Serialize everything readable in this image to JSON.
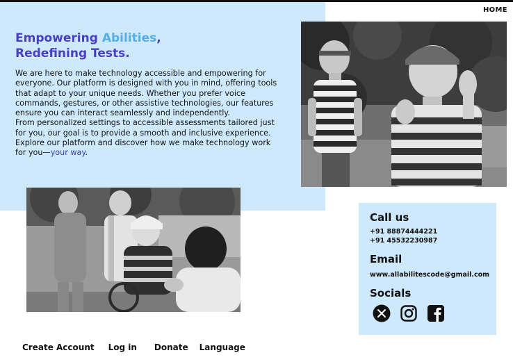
{
  "nav": {
    "home_label": "HOME"
  },
  "hero": {
    "title_part1": "Empowering ",
    "title_accent": "Abilities",
    "title_part2": ",",
    "title_line2": "Redefining Tests.",
    "paragraph1": "We are here to make technology accessible and empowering for everyone. Our platform is designed with you in mind, offering tools that adapt to your unique needs. Whether you prefer voice commands, gestures, or other assistive technologies, our features ensure you can interact seamlessly and independently.",
    "paragraph2_start": "From personalized settings to accessible assessments tailored just for you, our goal is to provide a smooth and inclusive experience. Explore our platform and discover how we make technology work for you—",
    "paragraph2_link": "your way",
    "paragraph2_end": "."
  },
  "contact": {
    "call_heading": "Call us",
    "phone1": "+91 88874444221",
    "phone2": "+91 45532230987",
    "email_heading": "Email",
    "email": "www.allabilitescode@gmail.com",
    "socials_heading": "Socials",
    "social_icons": [
      "x-icon",
      "instagram-icon",
      "facebook-icon"
    ]
  },
  "footer_nav": {
    "create_account": "Create Account",
    "login": "Log in",
    "donate": "Donate",
    "language": "Language"
  },
  "colors": {
    "panel_blue": "#cde9fb",
    "title_purple": "#4a3fc0",
    "title_accent": "#55aee8",
    "link_color": "#3a3aa8"
  }
}
